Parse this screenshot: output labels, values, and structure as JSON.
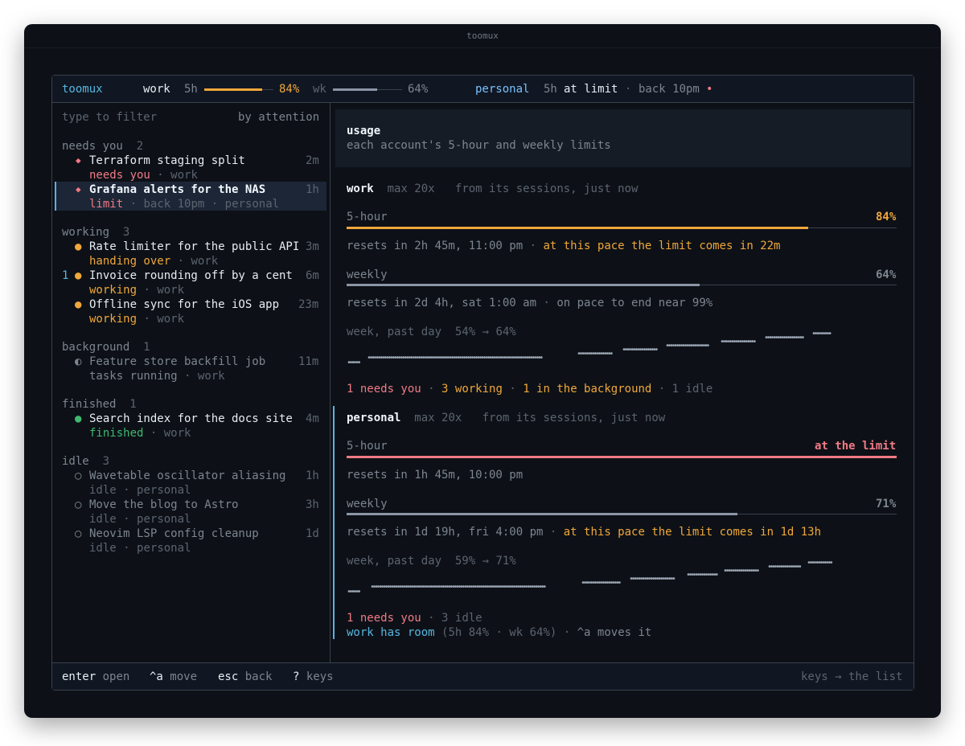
{
  "window": {
    "title": "toomux"
  },
  "topbar": {
    "app": "toomux",
    "work_label": "work",
    "work_5h_label": "5h",
    "work_5h_value": "84%",
    "work_5h_fraction": 0.84,
    "wk_label": "wk",
    "wk_value": "64%",
    "wk_fraction": 0.64,
    "personal_label": "personal",
    "personal_5h_label": "5h",
    "personal_5h_status": "at limit",
    "personal_sep": "·",
    "personal_back": "back 10pm",
    "personal_dot": "•"
  },
  "sidebar": {
    "filter_placeholder": "type to filter",
    "sort_label": "by attention",
    "groups": [
      {
        "name": "needs you",
        "count": "2",
        "items": [
          {
            "icon": "diamond-icon",
            "title": "Terraform staging split",
            "age": "2m",
            "status": "needs you",
            "sep": "·",
            "account": "work"
          },
          {
            "icon": "diamond-icon",
            "title": "Grafana alerts for the NAS",
            "age": "1h",
            "status": "limit",
            "sep": "·",
            "extra": "back 10pm",
            "sep2": "·",
            "account": "personal"
          }
        ]
      },
      {
        "name": "working",
        "count": "3",
        "items": [
          {
            "icon": "dot-icon",
            "title": "Rate limiter for the public API",
            "age": "3m",
            "status": "handing over",
            "sep": "·",
            "account": "work"
          },
          {
            "icon": "dot-icon",
            "marker": "1",
            "title": "Invoice rounding off by a cent",
            "age": "6m",
            "status": "working",
            "sep": "·",
            "account": "work"
          },
          {
            "icon": "dot-icon",
            "title": "Offline sync for the iOS app",
            "age": "23m",
            "status": "working",
            "sep": "·",
            "account": "work"
          }
        ]
      },
      {
        "name": "background",
        "count": "1",
        "items": [
          {
            "icon": "half-circle-icon",
            "title": "Feature store backfill job",
            "age": "11m",
            "status": "tasks running",
            "sep": "·",
            "account": "work"
          }
        ]
      },
      {
        "name": "finished",
        "count": "1",
        "items": [
          {
            "icon": "dot-icon",
            "title": "Search index for the docs site",
            "age": "4m",
            "status": "finished",
            "sep": "·",
            "account": "work"
          }
        ]
      },
      {
        "name": "idle",
        "count": "3",
        "items": [
          {
            "icon": "circle-icon",
            "title": "Wavetable oscillator aliasing",
            "age": "1h",
            "status": "idle",
            "sep": "·",
            "account": "personal"
          },
          {
            "icon": "circle-icon",
            "title": "Move the blog to Astro",
            "age": "3h",
            "status": "idle",
            "sep": "·",
            "account": "personal"
          },
          {
            "icon": "circle-icon",
            "title": "Neovim LSP config cleanup",
            "age": "1d",
            "status": "idle",
            "sep": "·",
            "account": "personal"
          }
        ]
      }
    ]
  },
  "usage": {
    "title": "usage",
    "subtitle": "each account's 5-hour and weekly limits"
  },
  "work": {
    "name": "work",
    "plan": "max 20x",
    "source": "from its sessions, just now",
    "five_hour_label": "5-hour",
    "five_hour_value": "84%",
    "five_hour_fraction": 0.84,
    "five_hour_resets": "resets in 2h 45m, 11:00 pm",
    "sep": "·",
    "five_hour_pace": "at this pace the limit comes in 22m",
    "weekly_label": "weekly",
    "weekly_value": "64%",
    "weekly_fraction": 0.64,
    "weekly_resets": "resets in 2d 4h, sat 1:00 am",
    "weekly_pace": "on pace to end near 99%",
    "trend_label": "week, past day",
    "trend_value": "54% → 64%",
    "summary_needs": "1 needs you",
    "summary_working": "3 working",
    "summary_background": "1 in the background",
    "summary_idle": "1 idle"
  },
  "personal": {
    "name": "personal",
    "plan": "max 20x",
    "source": "from its sessions, just now",
    "five_hour_label": "5-hour",
    "five_hour_value": "at the limit",
    "five_hour_fraction": 1.0,
    "five_hour_resets": "resets in 1h 45m, 10:00 pm",
    "weekly_label": "weekly",
    "weekly_value": "71%",
    "weekly_fraction": 0.71,
    "weekly_resets": "resets in 1d 19h, fri 4:00 pm",
    "sep": "·",
    "weekly_pace": "at this pace the limit comes in 1d 13h",
    "trend_label": "week, past day",
    "trend_value": "59% → 71%",
    "summary_needs": "1 needs you",
    "summary_idle": "3 idle",
    "hint_room": "work has room",
    "hint_detail": "(5h 84% · wk 64%)",
    "hint_move": "^a moves it"
  },
  "footer": {
    "enter_key": "enter",
    "enter_label": "open",
    "move_key": "^a",
    "move_label": "move",
    "esc_key": "esc",
    "esc_label": "back",
    "help_key": "?",
    "help_label": "keys",
    "focus_hint": "keys → the list"
  },
  "colors": {
    "accent": "#56b6e0",
    "orange": "#f0a73a",
    "pink": "#f07a85",
    "green": "#3fb970"
  }
}
